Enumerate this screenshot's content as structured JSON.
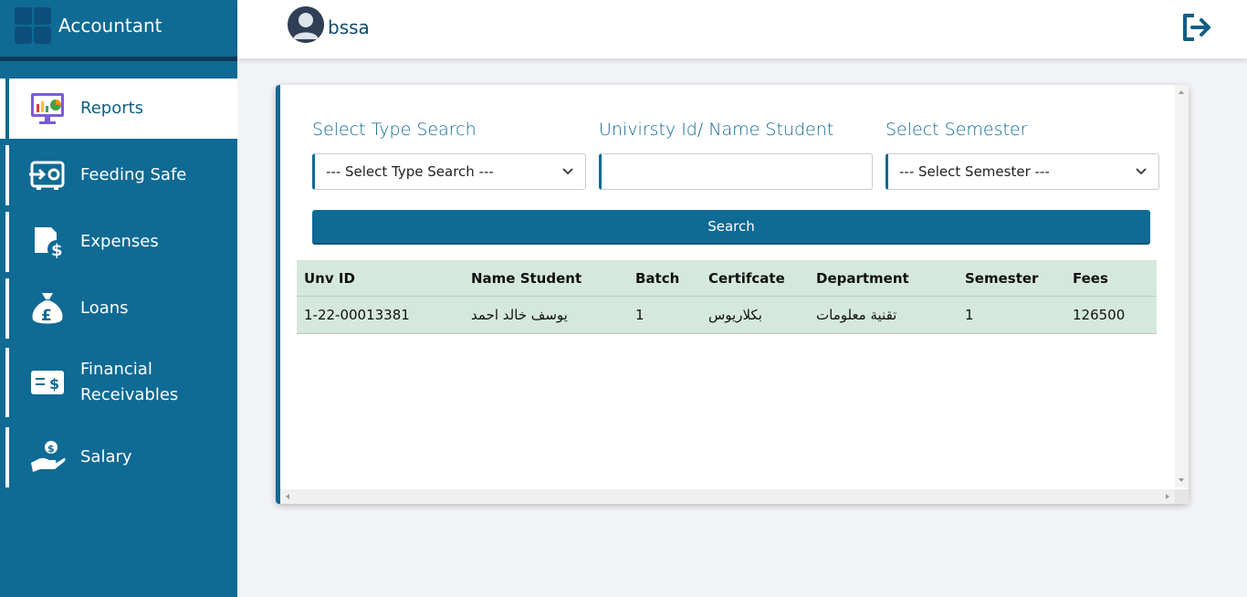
{
  "app": {
    "title": "Accountant"
  },
  "user": {
    "name": "bssa"
  },
  "sidebar": {
    "items": [
      {
        "label": "Reports",
        "icon": "reports-icon",
        "active": true
      },
      {
        "label": "Feeding Safe",
        "icon": "feeding-safe-icon",
        "active": false
      },
      {
        "label": "Expenses",
        "icon": "expenses-icon",
        "active": false
      },
      {
        "label": "Loans",
        "icon": "loans-icon",
        "active": false
      },
      {
        "label": "Financial Receivables",
        "icon": "receivables-icon",
        "active": false
      },
      {
        "label": "Salary",
        "icon": "salary-icon",
        "active": false
      }
    ]
  },
  "search": {
    "type_label": "Select Type Search",
    "type_value": "--- Select Type Search ---",
    "id_label": "Univirsty Id/ Name Student",
    "id_value": "",
    "semester_label": "Select Semester",
    "semester_value": "--- Select Semester ---",
    "button_label": "Search"
  },
  "table": {
    "headers": [
      "Unv ID",
      "Name Student",
      "Batch",
      "Certifcate",
      "Department",
      "Semester",
      "Fees"
    ],
    "rows": [
      [
        "1-22-00013381",
        "يوسف خالد احمد",
        "1",
        "بكلاريوس",
        "تقنية معلومات",
        "1",
        "126500"
      ]
    ]
  },
  "colors": {
    "primary": "#0f6a94",
    "table_bg": "#d5e8de",
    "page_bg": "#f3f4f8"
  }
}
